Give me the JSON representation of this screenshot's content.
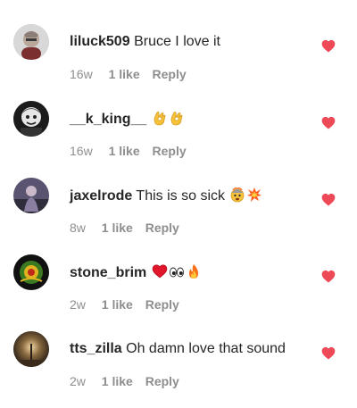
{
  "colors": {
    "heart": "#ed4956",
    "meta_text": "#8e8e8e",
    "username": "#262626"
  },
  "comments": [
    {
      "username": "liluck509",
      "text": "Bruce I love it",
      "emojis": [],
      "time": "16w",
      "likes": "1 like",
      "reply": "Reply",
      "liked": true,
      "heart_icon": "heart-filled-icon"
    },
    {
      "username": "__k_king__",
      "text": "",
      "emojis": [
        "ok-hand-emoji-icon",
        "ok-hand-emoji-icon"
      ],
      "time": "16w",
      "likes": "1 like",
      "reply": "Reply",
      "liked": true,
      "heart_icon": "heart-filled-icon"
    },
    {
      "username": "jaxelrode",
      "text": "This is so sick",
      "emojis": [
        "exploding-head-emoji-icon",
        "collision-emoji-icon"
      ],
      "time": "8w",
      "likes": "1 like",
      "reply": "Reply",
      "liked": true,
      "heart_icon": "heart-filled-icon"
    },
    {
      "username": "stone_brim",
      "text": "",
      "emojis": [
        "red-heart-emoji-icon",
        "eyes-emoji-icon",
        "fire-emoji-icon"
      ],
      "time": "2w",
      "likes": "1 like",
      "reply": "Reply",
      "liked": true,
      "heart_icon": "heart-filled-icon"
    },
    {
      "username": "tts_zilla",
      "text": "Oh damn love that sound",
      "emojis": [],
      "time": "2w",
      "likes": "1 like",
      "reply": "Reply",
      "liked": true,
      "heart_icon": "heart-filled-icon"
    }
  ]
}
